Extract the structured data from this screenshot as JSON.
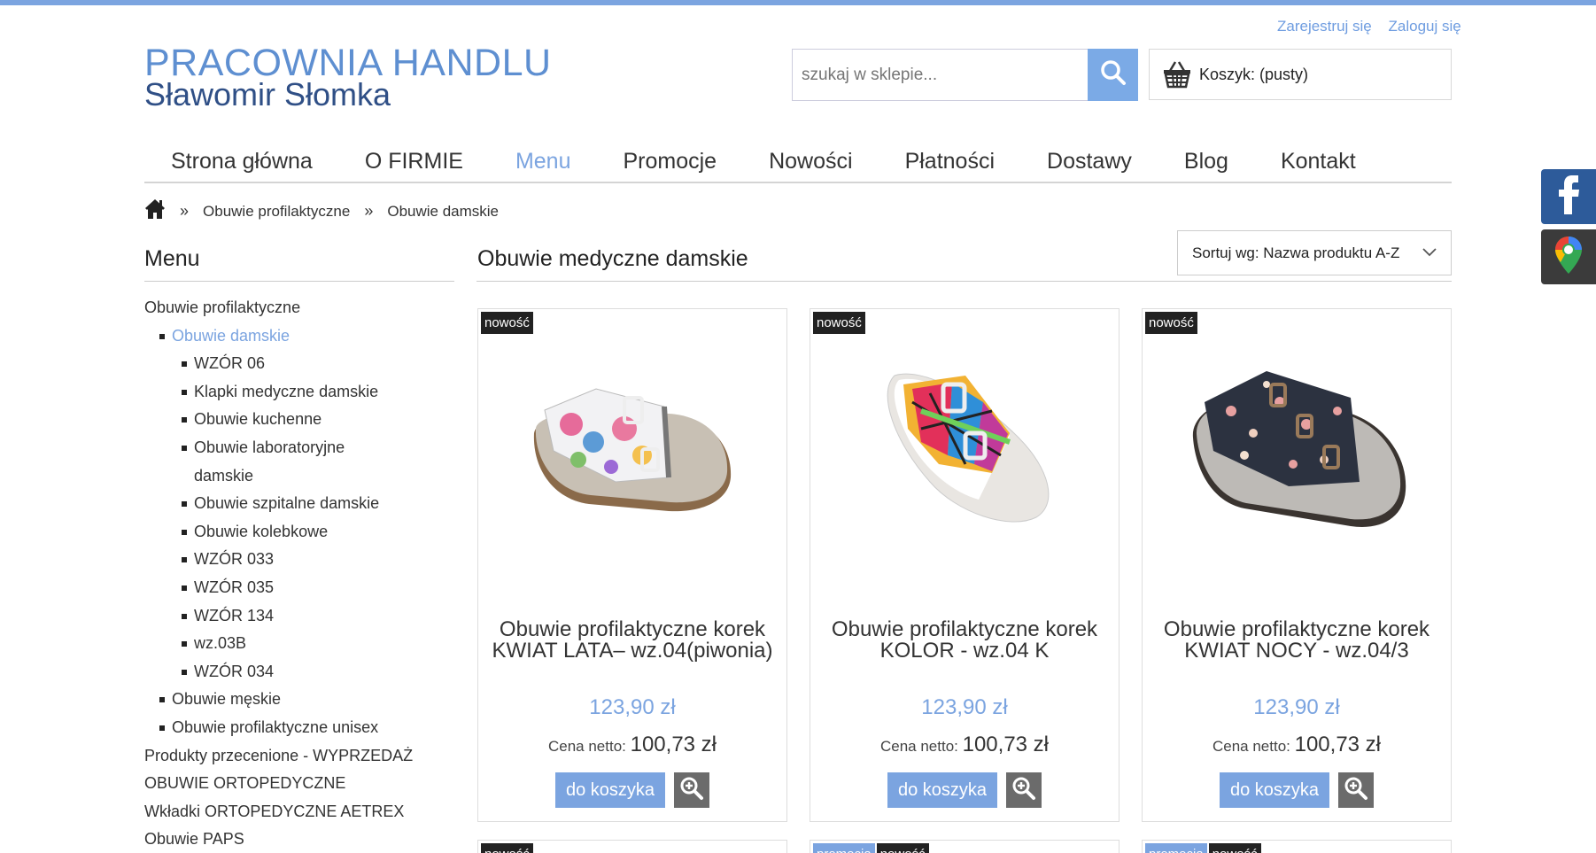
{
  "header": {
    "logo_line1": "PRACOWNIA HANDLU",
    "logo_line2": "Sławomir Słomka",
    "register": "Zarejestruj się",
    "login": "Zaloguj się",
    "search_placeholder": "szukaj w sklepie...",
    "cart_label": "Koszyk: (pusty)"
  },
  "nav": [
    "Strona główna",
    "O FIRMIE",
    "Menu",
    "Promocje",
    "Nowości",
    "Płatności",
    "Dostawy",
    "Blog",
    "Kontakt"
  ],
  "breadcrumb": {
    "sep": "»",
    "items": [
      "Obuwie profilaktyczne",
      "Obuwie damskie"
    ]
  },
  "sidebar": {
    "title": "Menu",
    "items": [
      "Obuwie profilaktyczne",
      "Obuwie damskie",
      "WZÓR 06",
      "Klapki medyczne damskie",
      "Obuwie kuchenne",
      "Obuwie laboratoryjne damskie",
      "Obuwie szpitalne damskie",
      "Obuwie kolebkowe",
      "WZÓR 033",
      "WZÓR 035",
      "WZÓR 134",
      "wz.03B",
      "WZÓR 034",
      "Obuwie męskie",
      "Obuwie profilaktyczne unisex",
      "Produkty przecenione - WYPRZEDAŻ",
      "OBUWIE ORTOPEDYCZNE",
      "Wkładki ORTOPEDYCZNE AETREX",
      "Obuwie PAPS"
    ]
  },
  "content": {
    "title": "Obuwie medyczne damskie",
    "sort_label": "Sortuj wg: Nazwa produktu A-Z"
  },
  "products": [
    {
      "badge": "nowość",
      "name": "Obuwie profilaktyczne korek KWIAT LATA– wz.04(piwonia)",
      "price": "123,90 zł",
      "net_label": "Cena netto:",
      "net_value": "100,73 zł",
      "cart_btn": "do koszyka"
    },
    {
      "badge": "nowość",
      "name": "Obuwie profilaktyczne korek KOLOR - wz.04 K",
      "price": "123,90 zł",
      "net_label": "Cena netto:",
      "net_value": "100,73 zł",
      "cart_btn": "do koszyka"
    },
    {
      "badge": "nowość",
      "name": "Obuwie profilaktyczne korek KWIAT NOCY - wz.04/3",
      "price": "123,90 zł",
      "net_label": "Cena netto:",
      "net_value": "100,73 zł",
      "cart_btn": "do koszyka"
    }
  ],
  "row2_tags": [
    [
      "nowość"
    ],
    [
      "promocja",
      "nowość"
    ],
    [
      "promocja",
      "nowość"
    ]
  ],
  "colors": {
    "accent": "#7ba4e0",
    "logo_blue": "#5e8fd1",
    "logo_dark": "#2f4f86",
    "badge_bg": "#222222",
    "facebook": "#2d5b9a"
  },
  "icons": {
    "search": "search-icon",
    "cart": "basket-icon",
    "home": "home-icon",
    "zoom": "zoom-in-icon",
    "facebook": "facebook-icon",
    "maps": "map-pin-icon",
    "sort": "chevron-down-icon"
  }
}
